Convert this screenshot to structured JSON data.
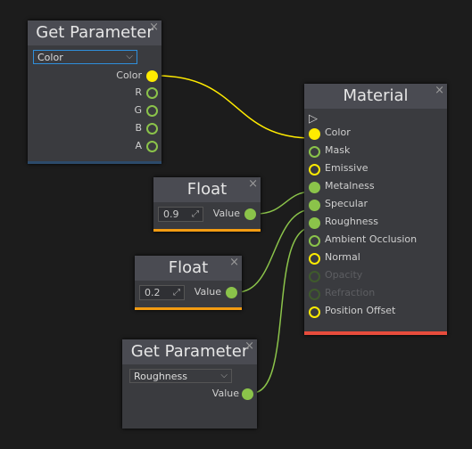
{
  "get_param_1": {
    "title": "Get Parameter",
    "selected": "Color",
    "outputs": [
      "Color",
      "R",
      "G",
      "B",
      "A"
    ]
  },
  "material": {
    "title": "Material",
    "inputs": [
      "Color",
      "Mask",
      "Emissive",
      "Metalness",
      "Specular",
      "Roughness",
      "Ambient Occlusion",
      "Normal",
      "Opacity",
      "Refraction",
      "Position Offset"
    ]
  },
  "float_1": {
    "title": "Float",
    "value": "0.9",
    "output": "Value"
  },
  "float_2": {
    "title": "Float",
    "value": "0.2",
    "output": "Value"
  },
  "get_param_2": {
    "title": "Get Parameter",
    "selected": "Roughness",
    "output": "Value"
  },
  "colors": {
    "yellow": "#ffeb00",
    "green": "#8bc34a",
    "float_bar": "#f39c12",
    "material_bar": "#e74c3c",
    "param_bar": "#2c4a6a"
  },
  "icons": {
    "close": "×",
    "chevron": "⌵",
    "expand": "⤢",
    "output_arrow": "▷"
  }
}
